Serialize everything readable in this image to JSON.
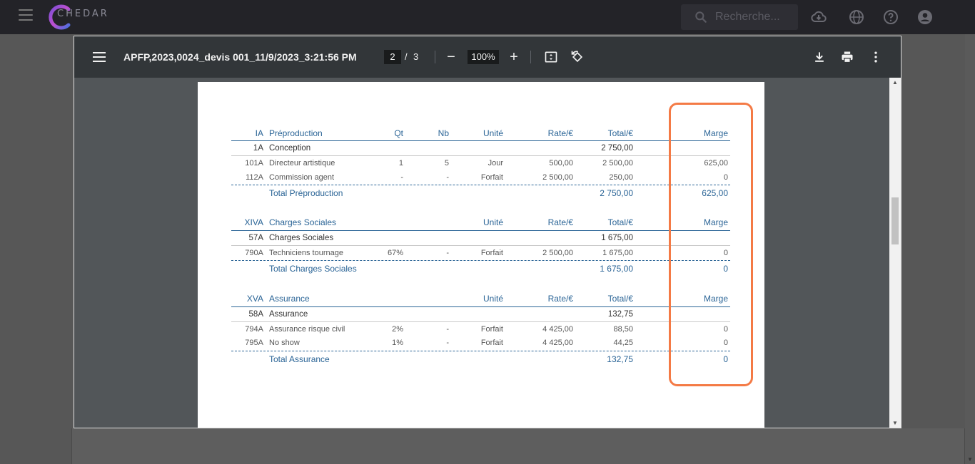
{
  "app": {
    "brand": "CHEDAR",
    "search_placeholder": "Recherche..."
  },
  "viewer": {
    "title": "APFP,2023,0024_devis 001_11/9/2023_3:21:56 PM",
    "page_current": "2",
    "page_sep": "/",
    "page_total": "3",
    "zoom": "100%",
    "zoom_out": "−",
    "zoom_in": "+"
  },
  "sections": [
    {
      "code": "IA",
      "name": "Préproduction",
      "headers": {
        "qt": "Qt",
        "nb": "Nb",
        "unite": "Unité",
        "rate": "Rate/€",
        "total": "Total/€",
        "marge": "Marge"
      },
      "sub": {
        "code": "1A",
        "name": "Conception",
        "total": "2 750,00"
      },
      "rows": [
        {
          "code": "101A",
          "name": "Directeur artistique",
          "qt": "1",
          "nb": "5",
          "unite": "Jour",
          "rate": "500,00",
          "total": "2 500,00",
          "marge": "625,00"
        },
        {
          "code": "112A",
          "name": "Commission agent",
          "qt": "-",
          "nb": "-",
          "unite": "Forfait",
          "rate": "2 500,00",
          "total": "250,00",
          "marge": "0"
        }
      ],
      "footer": {
        "label": "Total Préproduction",
        "total": "2 750,00",
        "marge": "625,00"
      }
    },
    {
      "code": "XIVA",
      "name": "Charges Sociales",
      "headers": {
        "unite": "Unité",
        "rate": "Rate/€",
        "total": "Total/€",
        "marge": "Marge"
      },
      "sub": {
        "code": "57A",
        "name": "Charges Sociales",
        "total": "1 675,00"
      },
      "rows": [
        {
          "code": "790A",
          "name": "Techniciens tournage",
          "qt": "67%",
          "nb": "-",
          "unite": "Forfait",
          "rate": "2 500,00",
          "total": "1 675,00",
          "marge": "0"
        }
      ],
      "footer": {
        "label": "Total Charges Sociales",
        "total": "1 675,00",
        "marge": "0"
      }
    },
    {
      "code": "XVA",
      "name": "Assurance",
      "headers": {
        "unite": "Unité",
        "rate": "Rate/€",
        "total": "Total/€",
        "marge": "Marge"
      },
      "sub": {
        "code": "58A",
        "name": "Assurance",
        "total": "132,75"
      },
      "rows": [
        {
          "code": "794A",
          "name": "Assurance risque civil",
          "qt": "2%",
          "nb": "-",
          "unite": "Forfait",
          "rate": "4 425,00",
          "total": "88,50",
          "marge": "0"
        },
        {
          "code": "795A",
          "name": "No show",
          "qt": "1%",
          "nb": "-",
          "unite": "Forfait",
          "rate": "4 425,00",
          "total": "44,25",
          "marge": "0"
        }
      ],
      "footer": {
        "label": "Total Assurance",
        "total": "132,75",
        "marge": "0"
      }
    }
  ],
  "highlight_color": "#f47a45"
}
